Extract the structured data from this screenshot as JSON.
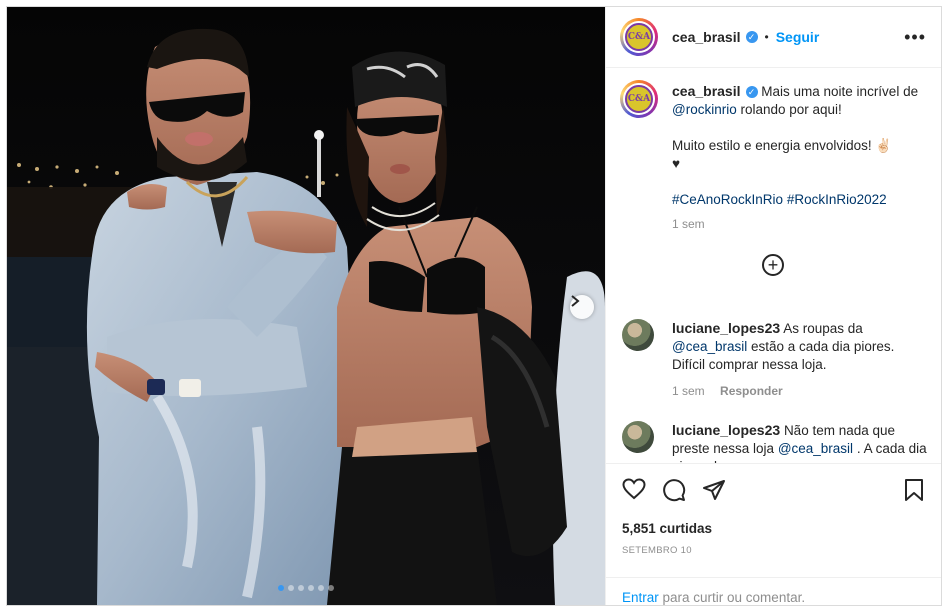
{
  "post": {
    "username": "cea_brasil",
    "avatar_text": "C&A",
    "follow_label": "Seguir",
    "separator": "•",
    "more_icon": "more-horizontal-icon",
    "verified_icon": "verified-badge-icon"
  },
  "caption": {
    "username": "cea_brasil",
    "line1_pre": "Mais uma noite incrível de ",
    "mention": "@rockinrio",
    "line1_post": " rolando por aqui!",
    "line2": "Muito estilo e energia envolvidos! ✌🏻",
    "heart": "♥",
    "hashtag1": "#CeAnoRockInRio",
    "hashtag2": "#RockInRio2022",
    "time": "1 sem"
  },
  "load_more_icon": "plus-circle-icon",
  "comments": [
    {
      "username": "luciane_lopes23",
      "text_pre": "As roupas da ",
      "mention": "@cea_brasil",
      "text_post": " estão a cada dia piores. Difícil comprar nessa loja.",
      "time": "1 sem",
      "reply_label": "Responder"
    },
    {
      "username": "luciane_lopes23",
      "text_pre": "Não tem nada que preste nessa loja ",
      "mention": "@cea_brasil",
      "text_post": " . A cada dia piorando"
    }
  ],
  "actions": {
    "like_icon": "heart-icon",
    "comment_icon": "comment-icon",
    "share_icon": "send-icon",
    "save_icon": "bookmark-icon"
  },
  "likes_text": "5,851 curtidas",
  "date_text": "SETEMBRO 10",
  "login": {
    "enter_label": "Entrar",
    "rest_text": " para curtir ou comentar."
  },
  "carousel": {
    "total_slides": 6,
    "current_slide": 1,
    "next_icon": "chevron-right-icon"
  },
  "colors": {
    "accent": "#0095f6",
    "link": "#00376b",
    "muted": "#8e8e8e",
    "verified": "#3897f0"
  }
}
